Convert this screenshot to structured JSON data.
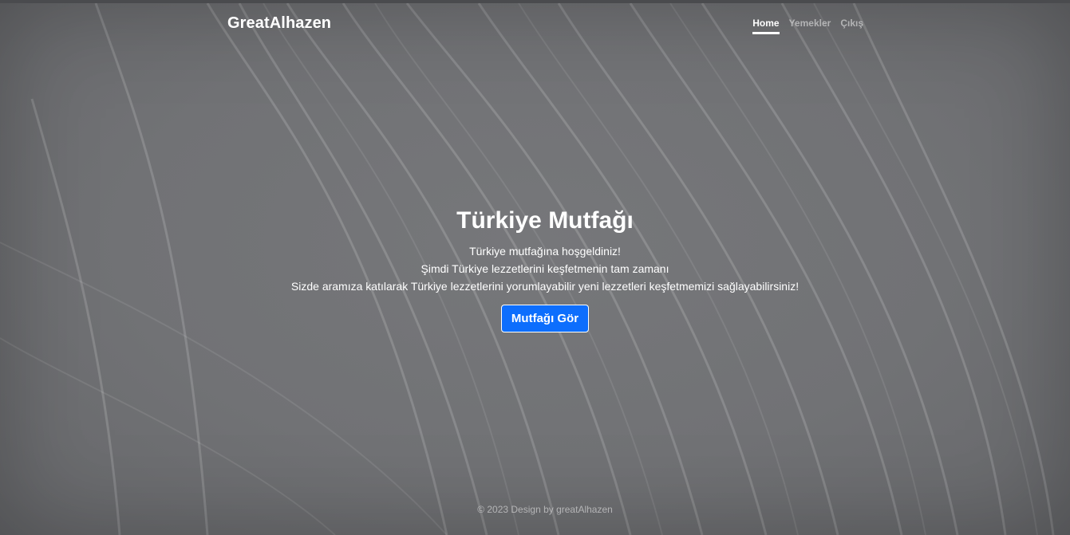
{
  "navbar": {
    "brand": "GreatAlhazen",
    "links": [
      {
        "label": "Home",
        "active": true
      },
      {
        "label": "Yemekler",
        "active": false
      },
      {
        "label": "Çıkış",
        "active": false
      }
    ]
  },
  "hero": {
    "title": "Türkiye Mutfağı",
    "lines": [
      "Türkiye mutfağına hoşgeldiniz!",
      "Şimdi Türkiye lezzetlerini keşfetmenin tam zamanı",
      "Sizde aramıza katılarak Türkiye lezzetlerini yorumlayabilir yeni lezzetleri keşfetmemizi sağlayabilirsiniz!"
    ],
    "button_label": "Mutfağı Gör"
  },
  "footer": {
    "text": "© 2023 Design by greatAlhazen"
  },
  "colors": {
    "background": "#727376",
    "button": "#0d6efd",
    "text": "#ffffff"
  }
}
